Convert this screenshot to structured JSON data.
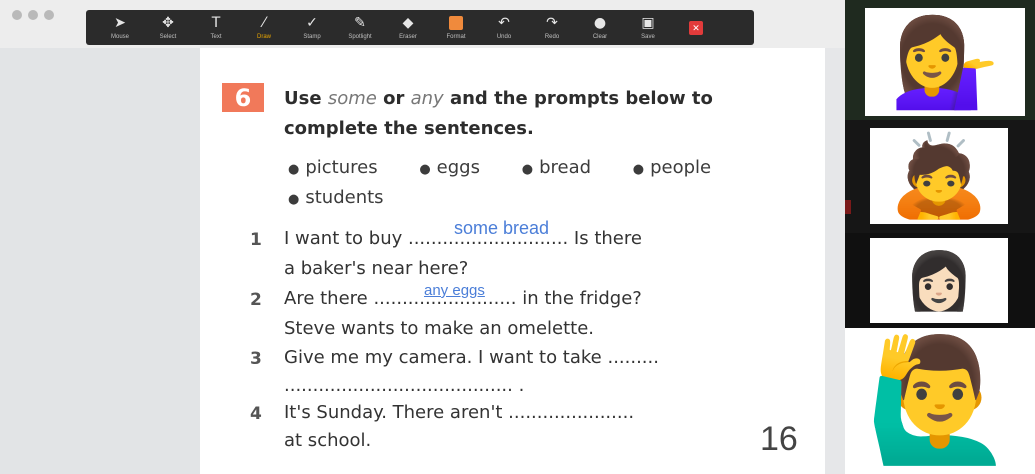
{
  "toolbar": {
    "tools": [
      {
        "label": "Mouse",
        "icon": "mouse-pointer-icon",
        "glyph": "➤"
      },
      {
        "label": "Select",
        "icon": "select-icon",
        "glyph": "✥"
      },
      {
        "label": "Text",
        "icon": "text-icon",
        "glyph": "T"
      },
      {
        "label": "Draw",
        "icon": "draw-icon",
        "glyph": "⁄",
        "active": true
      },
      {
        "label": "Stamp",
        "icon": "stamp-icon",
        "glyph": "✓"
      },
      {
        "label": "Spotlight",
        "icon": "spotlight-icon",
        "glyph": "✎"
      },
      {
        "label": "Eraser",
        "icon": "eraser-icon",
        "glyph": "◆"
      },
      {
        "label": "Format",
        "icon": "format-icon",
        "glyph": "■"
      },
      {
        "label": "Undo",
        "icon": "undo-icon",
        "glyph": "↶"
      },
      {
        "label": "Redo",
        "icon": "redo-icon",
        "glyph": "↷"
      },
      {
        "label": "Clear",
        "icon": "clear-icon",
        "glyph": "●"
      },
      {
        "label": "Save",
        "icon": "save-icon",
        "glyph": "▣"
      }
    ]
  },
  "exercise": {
    "number": "6",
    "instruction_a": "Use ",
    "word_some": "some",
    "instruction_b": " or ",
    "word_any": "any",
    "instruction_c": " and the prompts below to complete the sentences.",
    "prompts": [
      "pictures",
      "eggs",
      "bread",
      "people",
      "students"
    ],
    "items": [
      {
        "num": "1",
        "line1_a": "I want to buy ",
        "line1_blank": "...........................",
        "line1_b": ". Is there",
        "line2": "a baker's near here?",
        "answer": "some bread"
      },
      {
        "num": "2",
        "line1_a": "Are there ...",
        "line1_blank": "......................",
        "line1_b": " in the fridge?",
        "line2": "Steve wants to make an omelette.",
        "answer": "any eggs"
      },
      {
        "num": "3",
        "line1_a": "Give me my camera. I want to take .........",
        "line2": "........................................ ."
      },
      {
        "num": "4",
        "line1_a": "It's Sunday. There aren't ......................",
        "line2": "at school."
      }
    ],
    "page_number": "16"
  },
  "participants": [
    {
      "emoji": "💁‍♀️",
      "icon": "woman-tipping-hand-icon"
    },
    {
      "emoji": "🙇",
      "icon": "person-bowing-icon"
    },
    {
      "emoji": "👩🏻",
      "icon": "woman-face-icon"
    },
    {
      "emoji": "🙋‍♂️",
      "icon": "man-raising-hand-icon"
    }
  ]
}
